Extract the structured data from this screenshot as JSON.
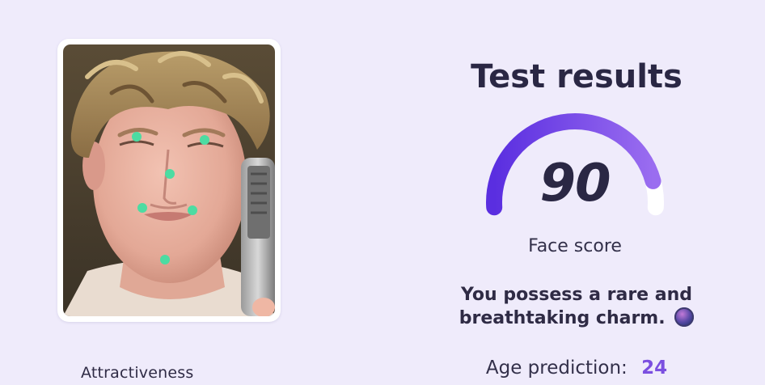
{
  "photo": {
    "description_icon": "face-photo",
    "landmark_color": "#4cdca2"
  },
  "labels": {
    "attractiveness": "Attractiveness"
  },
  "results": {
    "title": "Test results",
    "score": "90",
    "score_value": 90,
    "score_max": 100,
    "score_label": "Face score",
    "description": "You possess a rare and breathtaking charm.",
    "description_icon": "sparkle-orb-emoji",
    "age_label": "Age prediction:",
    "age_value": "24"
  },
  "colors": {
    "gauge_start": "#5a2ee0",
    "gauge_end": "#9a6df0",
    "gauge_remainder": "#ffffff",
    "accent": "#7b4fe0"
  }
}
